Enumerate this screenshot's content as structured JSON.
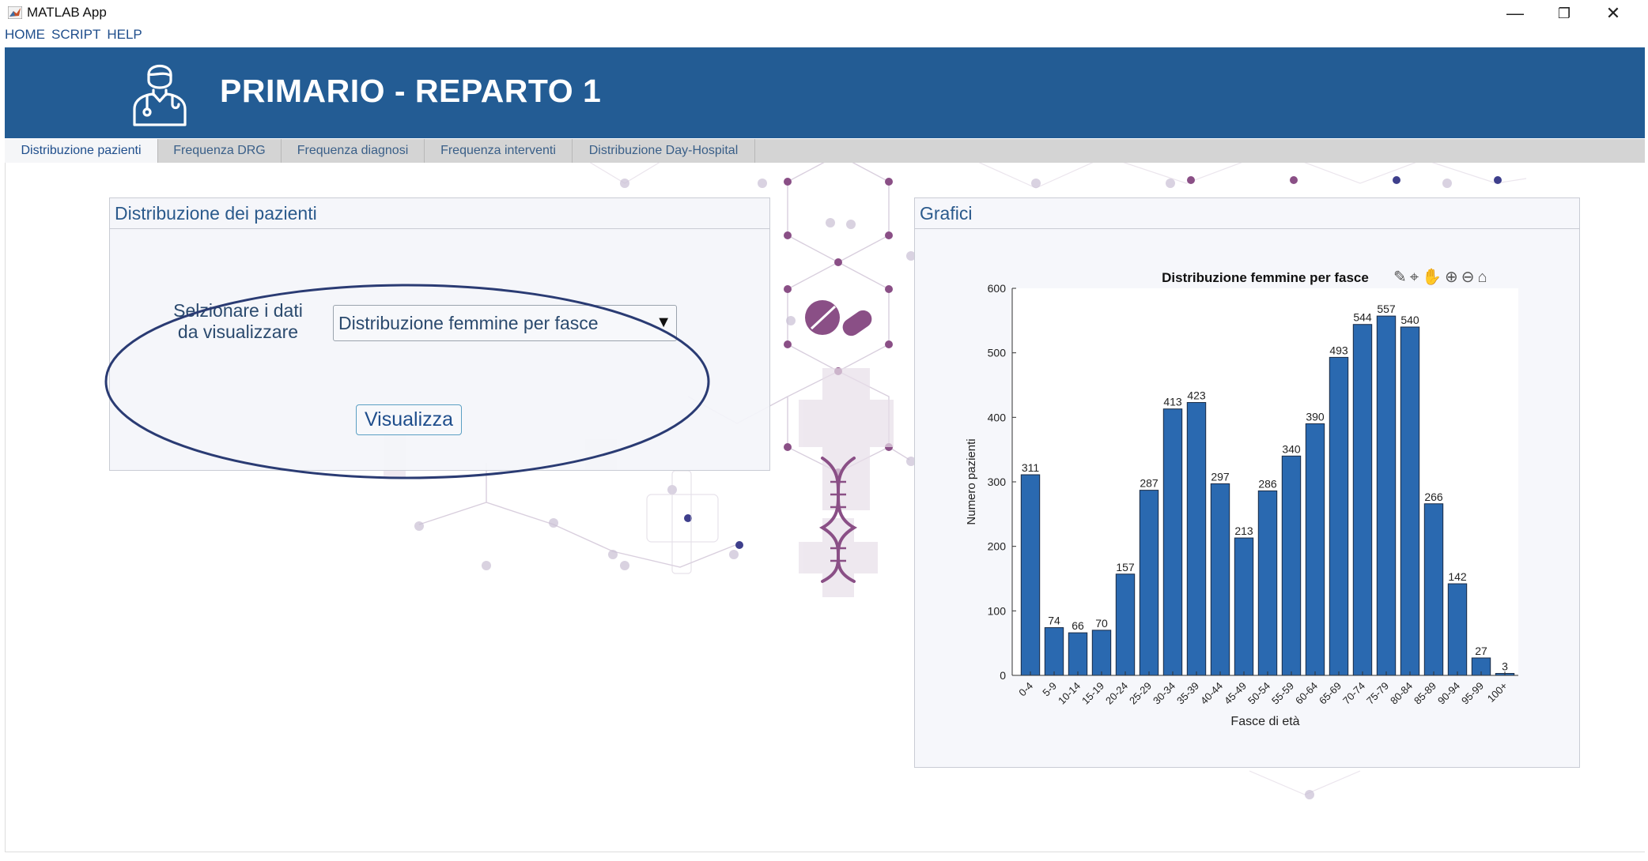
{
  "window": {
    "title": "MATLAB App",
    "minimize_glyph": "—",
    "restore_glyph": "❐",
    "close_glyph": "✕"
  },
  "menu": {
    "items": [
      "HOME",
      "SCRIPT",
      "HELP"
    ]
  },
  "header": {
    "title": "PRIMARIO - REPARTO 1",
    "icon": "doctor-icon"
  },
  "tabs": [
    {
      "label": "Distribuzione pazienti",
      "active": true
    },
    {
      "label": "Frequenza DRG",
      "active": false
    },
    {
      "label": "Frequenza diagnosi",
      "active": false
    },
    {
      "label": "Frequenza interventi",
      "active": false
    },
    {
      "label": "Distribuzione Day-Hospital",
      "active": false
    }
  ],
  "left_panel": {
    "title": "Distribuzione dei pazienti",
    "select_label_line1": "Selzionare i dati",
    "select_label_line2": "da visualizzare",
    "dropdown_value": "Distribuzione femmine per fasce",
    "button_label": "Visualizza"
  },
  "right_panel": {
    "title": "Grafici"
  },
  "colors": {
    "header": "#235c94",
    "bar": "#2a69b0",
    "annotation": "#2a3b73"
  },
  "chart_toolbar": [
    "brush-icon",
    "data-tip-icon",
    "pan-icon",
    "zoom-in-icon",
    "zoom-out-icon",
    "home-icon"
  ],
  "chart_data": {
    "type": "bar",
    "title": "Distribuzione femmine per fasce",
    "xlabel": "Fasce di età",
    "ylabel": "Numero pazienti",
    "ylim": [
      0,
      600
    ],
    "yticks": [
      0,
      100,
      200,
      300,
      400,
      500,
      600
    ],
    "categories": [
      "0-4",
      "5-9",
      "10-14",
      "15-19",
      "20-24",
      "25-29",
      "30-34",
      "35-39",
      "40-44",
      "45-49",
      "50-54",
      "55-59",
      "60-64",
      "65-69",
      "70-74",
      "75-79",
      "80-84",
      "85-89",
      "90-94",
      "95-99",
      "100+"
    ],
    "values": [
      311,
      74,
      66,
      70,
      157,
      287,
      413,
      423,
      297,
      213,
      286,
      340,
      390,
      493,
      544,
      557,
      540,
      266,
      142,
      27,
      3
    ],
    "grid": false
  }
}
